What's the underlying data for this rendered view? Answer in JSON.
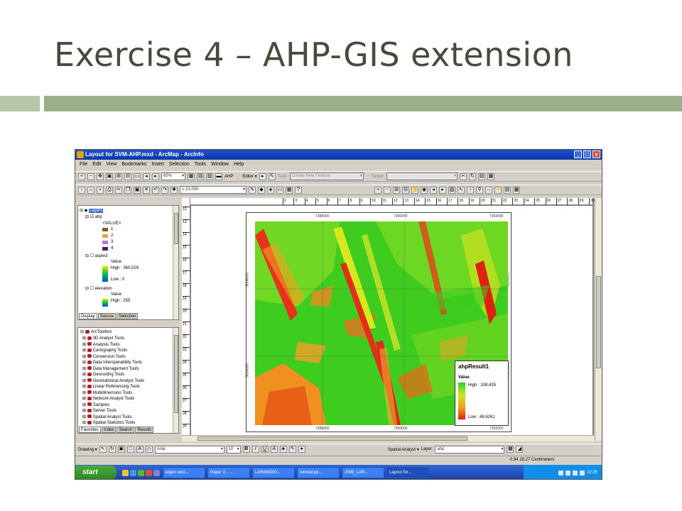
{
  "slide": {
    "title": "Exercise 4 – AHP-GIS extension"
  },
  "window": {
    "title": "Layout for SVM-AHP.mxd - ArcMap - ArcInfo",
    "btn_min": "_",
    "btn_max": "□",
    "btn_close": "x"
  },
  "menu": [
    "File",
    "Edit",
    "View",
    "Bookmarks",
    "Insert",
    "Selection",
    "Tools",
    "Window",
    "Help"
  ],
  "toolbar1": {
    "zoom_value": "65%",
    "ahp_label": "AHP",
    "editor_label": "Editor ▾",
    "task_label": "Task:",
    "task_value": "Create New Feature",
    "target_label": "Target:",
    "target_value": ""
  },
  "toolbar2": {
    "scale_value": "1:23.000"
  },
  "toc": {
    "root": "Layers",
    "ahp": {
      "name": "ahp",
      "field": "<VALUE>",
      "classes": [
        {
          "label": "1",
          "color": "#8a5a2e"
        },
        {
          "label": "2",
          "color": "#e0a04a"
        },
        {
          "label": "3",
          "color": "#b07cd0"
        },
        {
          "label": "4",
          "color": "#4a1a6a"
        }
      ]
    },
    "aspect": {
      "name": "aspect",
      "field": "Value",
      "high": "High : 360,029",
      "low": "Low : 0"
    },
    "elevation": {
      "name": "elevation",
      "field": "Value",
      "high": "High : 255"
    },
    "tabs": [
      "Display",
      "Source",
      "Selection"
    ]
  },
  "toolbox": {
    "root": "ArcToolbox",
    "items": [
      "3D Analyst Tools",
      "Analysis Tools",
      "Cartography Tools",
      "Conversion Tools",
      "Data Interoperability Tools",
      "Data Management Tools",
      "Geocoding Tools",
      "Geostatistical Analyst Tools",
      "Linear Referencing Tools",
      "Multidimension Tools",
      "Network Analyst Tools",
      "Samples",
      "Server Tools",
      "Spatial Analyst Tools",
      "Spatial Statistics Tools"
    ],
    "tabs": [
      "Favorites",
      "Index",
      "Search",
      "Results"
    ]
  },
  "ruler_labels": [
    "2",
    "3",
    "4",
    "5",
    "6",
    "7",
    "8",
    "9",
    "10",
    "11",
    "12",
    "13",
    "14",
    "15",
    "16",
    "17",
    "18",
    "19",
    "20",
    "21",
    "22",
    "23",
    "24",
    "25",
    "26",
    "27",
    "28",
    "29",
    "30",
    "31",
    "32",
    "33",
    "34",
    "35",
    "36",
    "37",
    "3"
  ],
  "ruler_v_labels": [
    "12",
    "13",
    "14",
    "15",
    "16",
    "17",
    "18",
    "19",
    "20",
    "21",
    "22",
    "23",
    "24",
    "25",
    "26",
    "27",
    "28",
    "29"
  ],
  "map": {
    "x_coords": [
      "7388000",
      "7390000",
      "7392000"
    ],
    "y_coords": [
      "5006000",
      "5004000"
    ]
  },
  "legend": {
    "title": "ahpResult1",
    "field": "Value",
    "high": "High : 108,435",
    "low": "Low : 48,6261",
    "colors": [
      "#2ecc2e",
      "#c8e81e",
      "#f4a020",
      "#e02010"
    ]
  },
  "drawing": {
    "drawing_label": "Drawing ▾",
    "font_value": "Arial",
    "size_value": "10",
    "spatial_analyst": "Spatial Analyst ▾",
    "layer_label": "Layer:",
    "layer_value": "ahp"
  },
  "status": {
    "coords": "-0,94  18,27 Centimeters"
  },
  "taskbar": {
    "start_label": "start",
    "tasks": [
      "eigen vect...",
      "Paper 3 - ...",
      "LARAM200...",
      "tutorial.pp...",
      "2009_LAR...",
      "Layout for..."
    ],
    "clock": "12:25"
  }
}
